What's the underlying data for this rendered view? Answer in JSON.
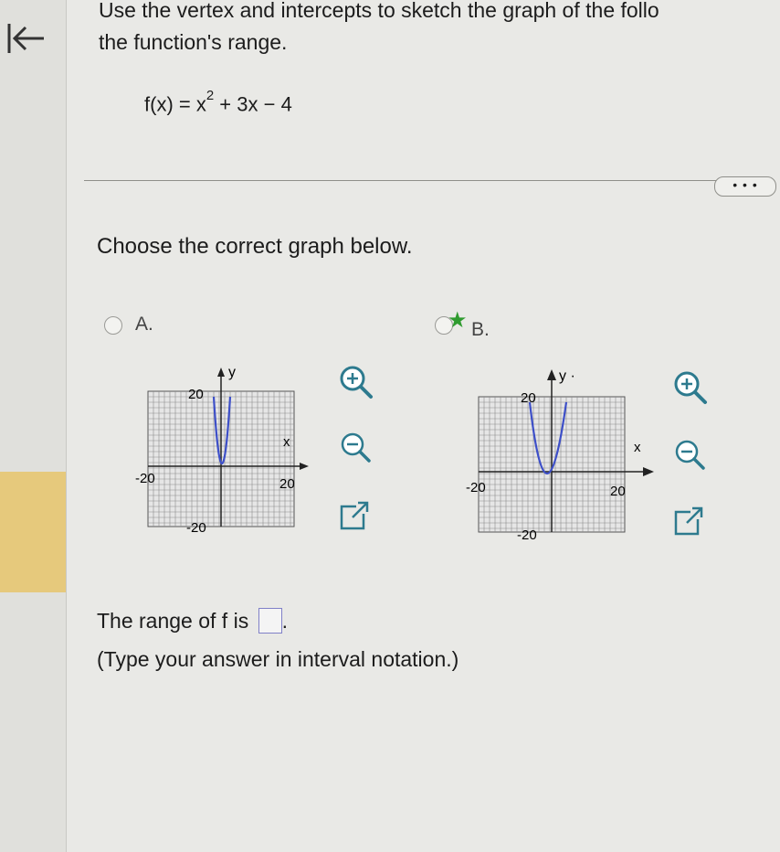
{
  "nav": {
    "back_icon": "back-arrow-icon"
  },
  "question": {
    "line1": "Use the vertex and intercepts to sketch the graph of the follo",
    "line2": "the function's range.",
    "formula_prefix": "f(x) = x",
    "formula_exp": "2",
    "formula_suffix": " + 3x − 4"
  },
  "more_button": "• • •",
  "prompt": "Choose the correct graph below.",
  "options": [
    {
      "label": "A.",
      "selected": false,
      "y_label": "y",
      "x_label": "x",
      "tick_pos_y": "20",
      "tick_neg_y": "-20",
      "tick_neg_x": "-20",
      "tick_pos_x": "20"
    },
    {
      "label": "B.",
      "selected": true,
      "y_label": "y ·",
      "x_label": "x",
      "tick_pos_y": "20",
      "tick_neg_y": "-20",
      "tick_neg_x": "-20",
      "tick_pos_x": "20"
    }
  ],
  "colors": {
    "curve": "#3d4fc8",
    "selected_star": "#2f9b2f"
  },
  "answer": {
    "prefix": "The range of f is",
    "value": "",
    "suffix": ".",
    "hint": "(Type your answer in interval notation.)"
  }
}
